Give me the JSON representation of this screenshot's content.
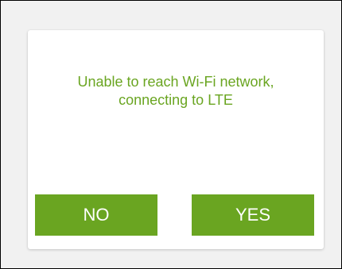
{
  "colors": {
    "accent": "#6aa521",
    "background": "#f1f1f1",
    "dialog": "#ffffff",
    "button_text": "#ffffff"
  },
  "dialog": {
    "message_line1": "Unable to reach Wi-Fi network,",
    "message_line2": "connecting to LTE",
    "no_label": "NO",
    "yes_label": "YES"
  }
}
